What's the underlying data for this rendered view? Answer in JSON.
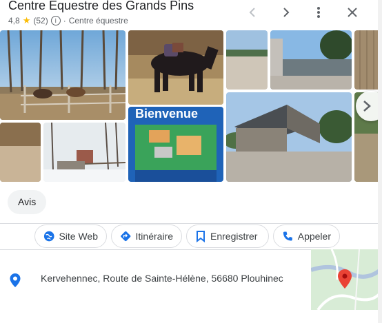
{
  "header": {
    "title": "Centre Équestre des Grands Pins",
    "rating": "4,8",
    "star": "★",
    "reviews": "(52)",
    "info": "i",
    "separator": "·",
    "category": "Centre équestre"
  },
  "photos": {
    "welcome_sign": "Bienvenue"
  },
  "chips": {
    "reviews": "Avis"
  },
  "actions": [
    {
      "label": "Site Web",
      "icon": "globe-icon"
    },
    {
      "label": "Itinéraire",
      "icon": "directions-icon"
    },
    {
      "label": "Enregistrer",
      "icon": "bookmark-icon"
    },
    {
      "label": "Appeler",
      "icon": "phone-icon"
    }
  ],
  "address": {
    "text": "Kervehennec, Route de Sainte-Hélène, 56680 Plouhinec"
  },
  "colors": {
    "accent": "#1a73e8",
    "star": "#fbbc04",
    "map_pin": "#ea4335"
  }
}
